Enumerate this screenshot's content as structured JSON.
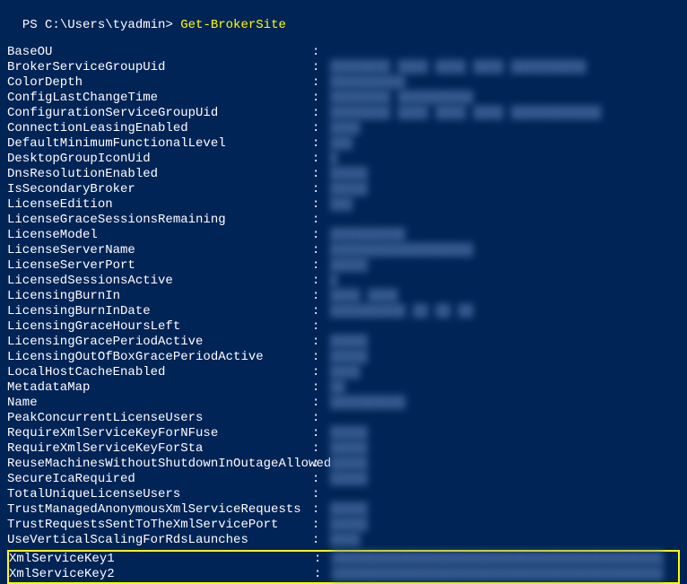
{
  "prompt": {
    "prefix": "PS C:\\Users\\tyadmin> ",
    "command": "Get-BrokerSite"
  },
  "properties": [
    {
      "name": "BaseOU",
      "value": ""
    },
    {
      "name": "BrokerServiceGroupUid",
      "value": "████████ ████ ████ ████ ██████████"
    },
    {
      "name": "ColorDepth",
      "value": "██████████"
    },
    {
      "name": "ConfigLastChangeTime",
      "value": "████████ ██████████"
    },
    {
      "name": "ConfigurationServiceGroupUid",
      "value": "████████ ████ ████ ████ ████████████"
    },
    {
      "name": "ConnectionLeasingEnabled",
      "value": "████"
    },
    {
      "name": "DefaultMinimumFunctionalLevel",
      "value": "███"
    },
    {
      "name": "DesktopGroupIconUid",
      "value": "█"
    },
    {
      "name": "DnsResolutionEnabled",
      "value": "█████"
    },
    {
      "name": "IsSecondaryBroker",
      "value": "█████"
    },
    {
      "name": "LicenseEdition",
      "value": "███"
    },
    {
      "name": "LicenseGraceSessionsRemaining",
      "value": ""
    },
    {
      "name": "LicenseModel",
      "value": "██████████"
    },
    {
      "name": "LicenseServerName",
      "value": "███████████████████"
    },
    {
      "name": "LicenseServerPort",
      "value": "█████"
    },
    {
      "name": "LicensedSessionsActive",
      "value": "█"
    },
    {
      "name": "LicensingBurnIn",
      "value": "████ ████"
    },
    {
      "name": "LicensingBurnInDate",
      "value": "██████████ ██ ██ ██"
    },
    {
      "name": "LicensingGraceHoursLeft",
      "value": ""
    },
    {
      "name": "LicensingGracePeriodActive",
      "value": "█████"
    },
    {
      "name": "LicensingOutOfBoxGracePeriodActive",
      "value": "█████"
    },
    {
      "name": "LocalHostCacheEnabled",
      "value": "████"
    },
    {
      "name": "MetadataMap",
      "value": "██"
    },
    {
      "name": "Name",
      "value": "██████████"
    },
    {
      "name": "PeakConcurrentLicenseUsers",
      "value": ""
    },
    {
      "name": "RequireXmlServiceKeyForNFuse",
      "value": "█████"
    },
    {
      "name": "RequireXmlServiceKeyForSta",
      "value": "█████"
    },
    {
      "name": "ReuseMachinesWithoutShutdownInOutageAllowed",
      "value": "█████"
    },
    {
      "name": "SecureIcaRequired",
      "value": "█████"
    },
    {
      "name": "TotalUniqueLicenseUsers",
      "value": ""
    },
    {
      "name": "TrustManagedAnonymousXmlServiceRequests",
      "value": "█████"
    },
    {
      "name": "TrustRequestsSentToTheXmlServicePort",
      "value": "█████"
    },
    {
      "name": "UseVerticalScalingForRdsLaunches",
      "value": "████"
    }
  ],
  "highlighted": [
    {
      "name": "XmlServiceKey1",
      "value": "████████████████████████████████████████████"
    },
    {
      "name": "XmlServiceKey2",
      "value": "████████████████████████████████████████████"
    }
  ]
}
